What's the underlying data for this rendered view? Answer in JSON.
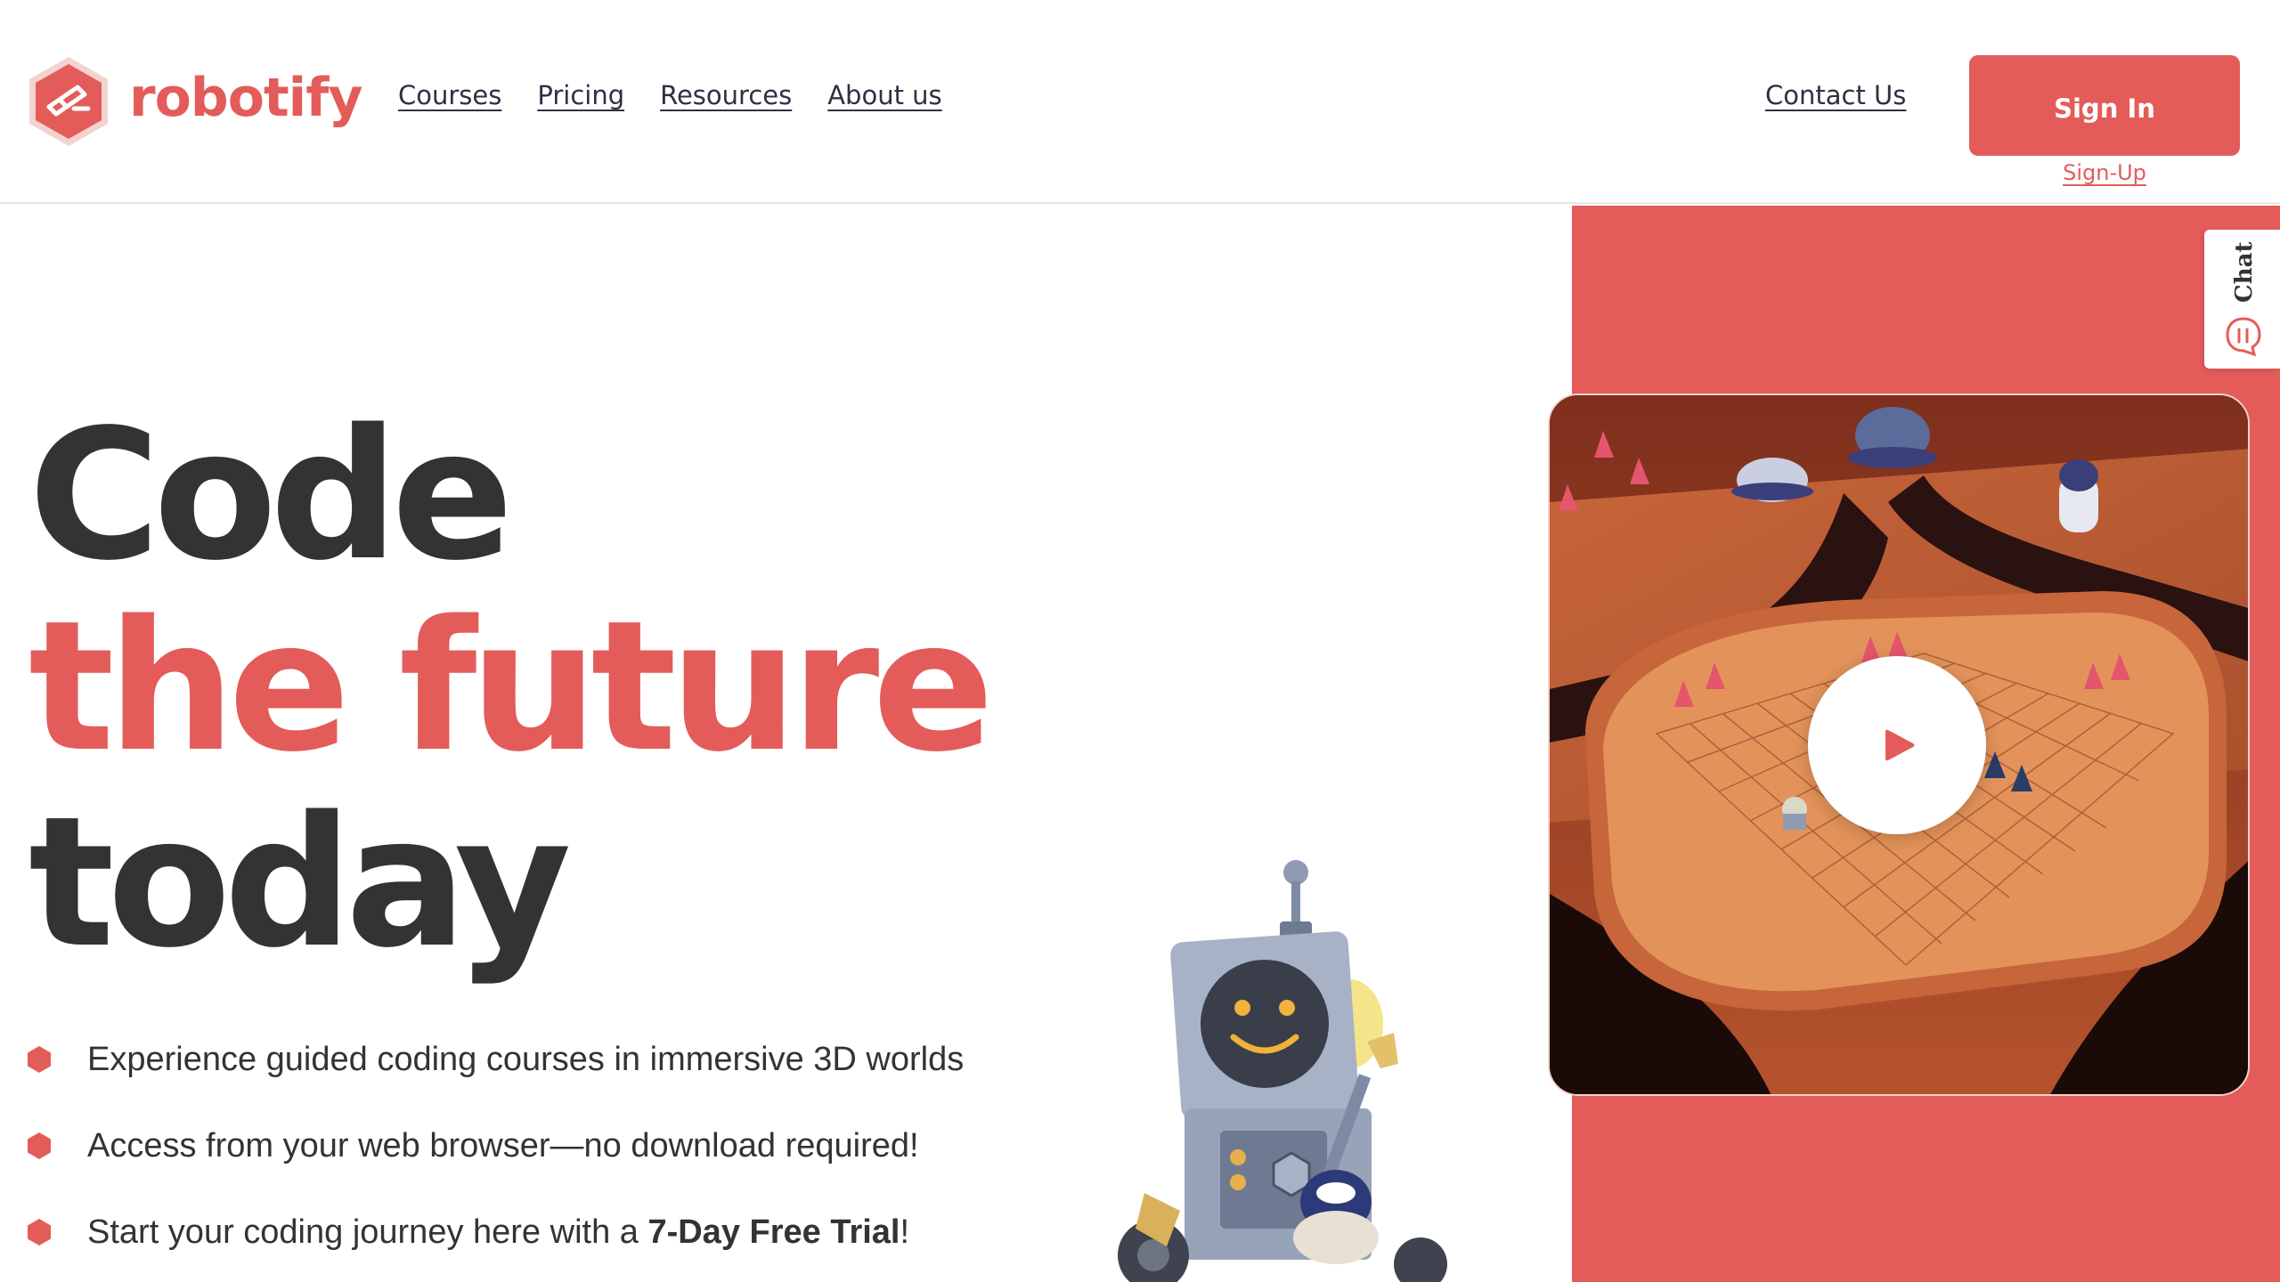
{
  "brand": {
    "name": "robotify",
    "logo_icon": "robotify-hexagon-logo",
    "accent_color": "#e35c5a",
    "text_color": "#333333"
  },
  "nav": {
    "items": [
      {
        "label": "Courses"
      },
      {
        "label": "Pricing"
      },
      {
        "label": "Resources"
      },
      {
        "label": "About us"
      }
    ],
    "contact_label": "Contact Us",
    "signin_label": "Sign In",
    "signup_label": "Sign-Up"
  },
  "chat": {
    "label": "Chat",
    "icon": "chat-bubble-icon"
  },
  "hero": {
    "line1": "Code",
    "line2": "the future",
    "line3": "today",
    "bullets": [
      {
        "text": "Experience guided coding courses in immersive 3D worlds"
      },
      {
        "text": "Access from your web browser—no download required!"
      },
      {
        "prefix": "Start your coding journey here with a ",
        "bold": "7-Day Free Trial",
        "suffix": "!"
      }
    ]
  },
  "video": {
    "play_icon": "play-icon",
    "scene": "mars-3d-coding-world"
  }
}
